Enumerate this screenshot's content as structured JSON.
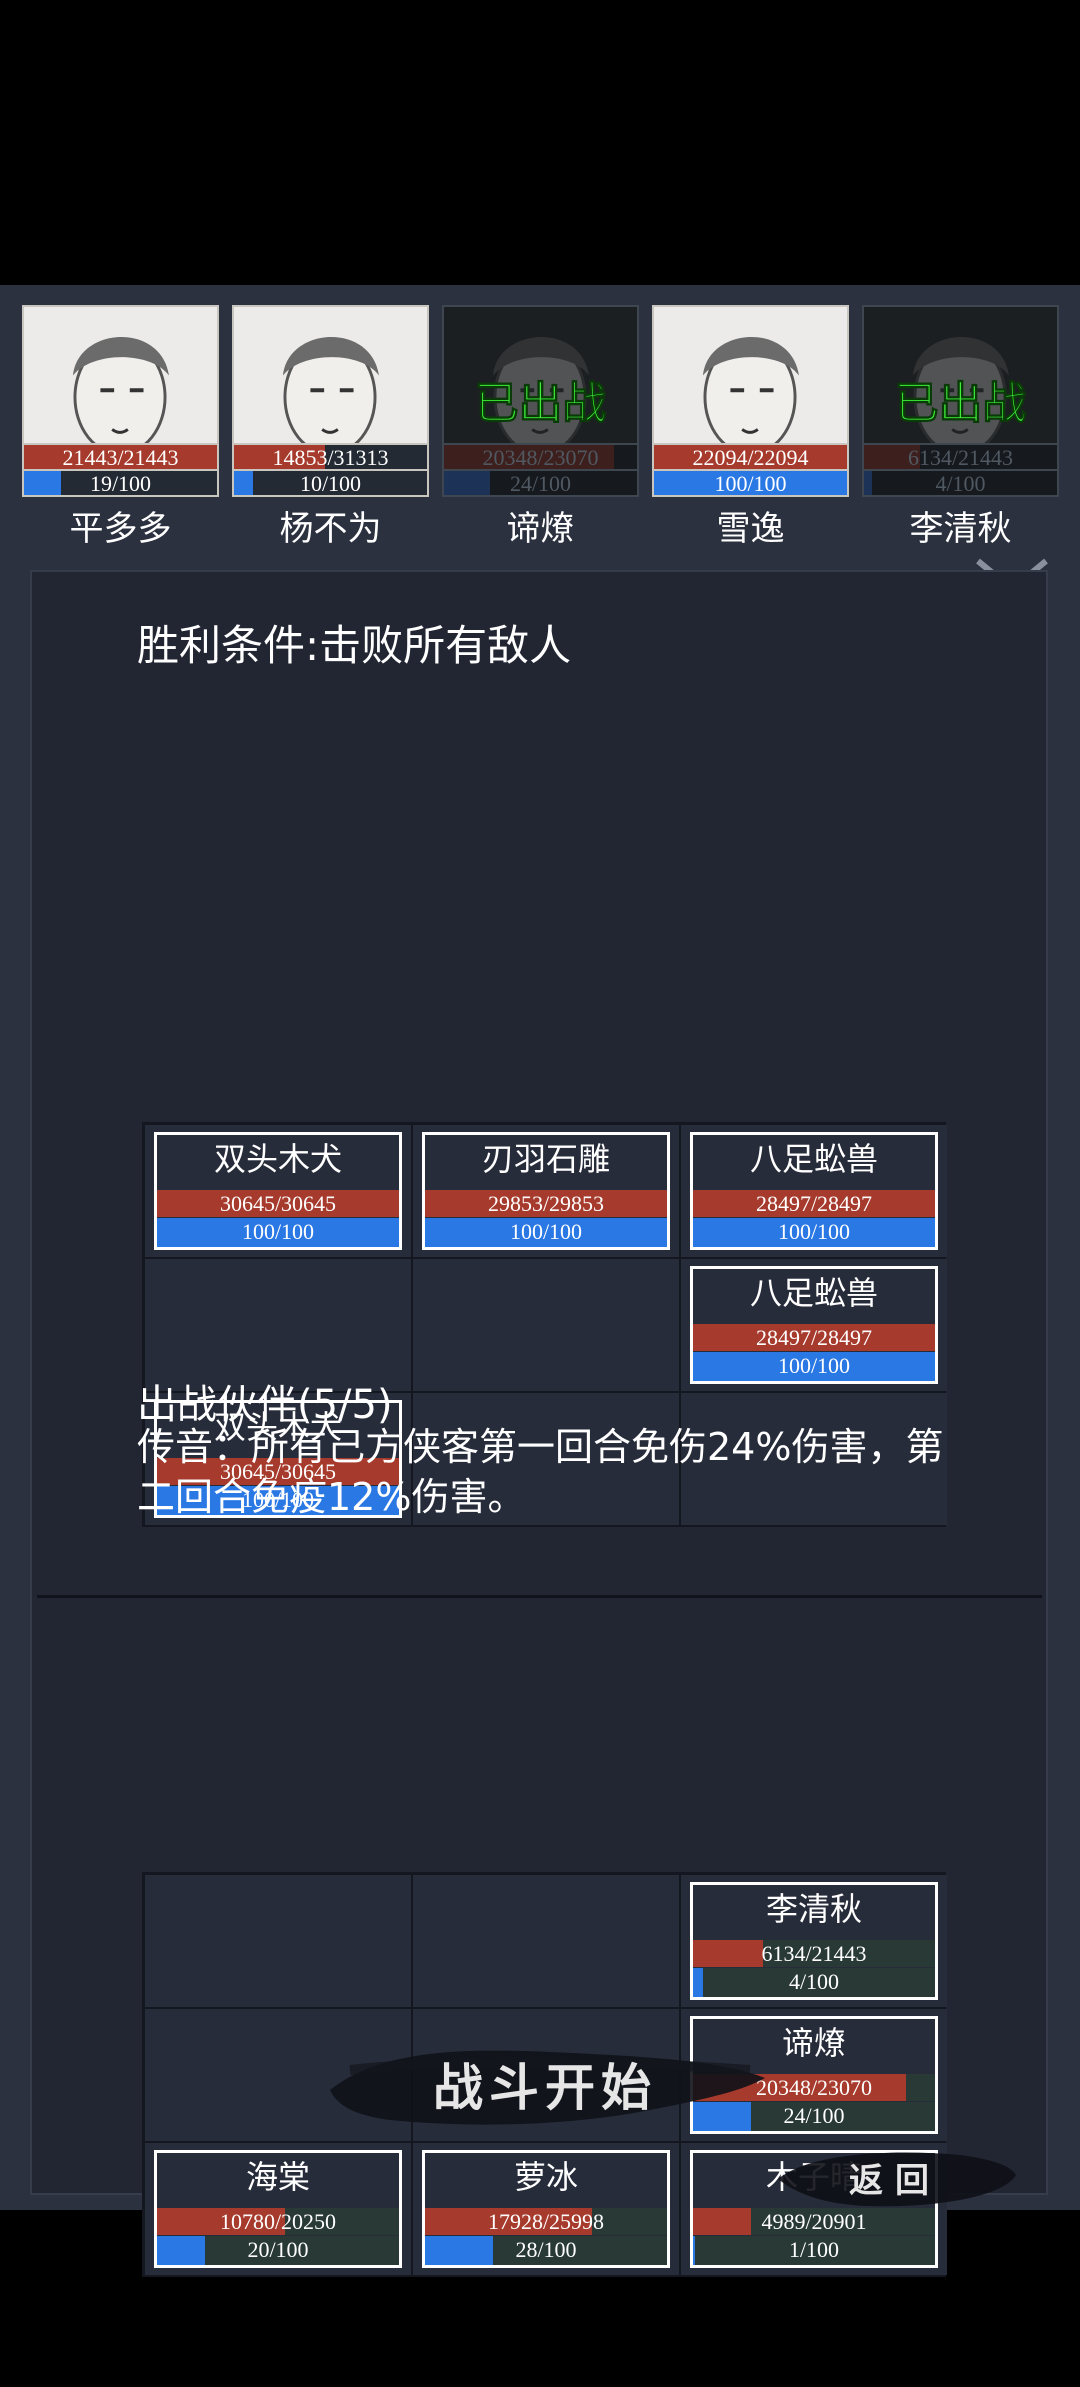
{
  "roster": [
    {
      "name": "平多多",
      "hp": "21443/21443",
      "hp_frac": 1.0,
      "mp": "19/100",
      "mp_frac": 0.19,
      "deployed": false
    },
    {
      "name": "杨不为",
      "hp": "14853/31313",
      "hp_frac": 0.47,
      "mp": "10/100",
      "mp_frac": 0.1,
      "deployed": false
    },
    {
      "name": "谛燎",
      "hp": "20348/23070",
      "hp_frac": 0.88,
      "mp": "24/100",
      "mp_frac": 0.24,
      "deployed": true
    },
    {
      "name": "雪逸",
      "hp": "22094/22094",
      "hp_frac": 1.0,
      "mp": "100/100",
      "mp_frac": 1.0,
      "deployed": false
    },
    {
      "name": "李清秋",
      "hp": "6134/21443",
      "hp_frac": 0.29,
      "mp": "4/100",
      "mp_frac": 0.04,
      "deployed": true
    }
  ],
  "deployed_label": "已出战",
  "victory_condition": "胜利条件:击败所有敌人",
  "enemies": [
    {
      "row": 0,
      "col": 0,
      "name": "双头木犬",
      "hp": "30645/30645",
      "hp_frac": 1.0,
      "mp": "100/100",
      "mp_frac": 1.0
    },
    {
      "row": 0,
      "col": 1,
      "name": "刃羽石雕",
      "hp": "29853/29853",
      "hp_frac": 1.0,
      "mp": "100/100",
      "mp_frac": 1.0
    },
    {
      "row": 0,
      "col": 2,
      "name": "八足蚣兽",
      "hp": "28497/28497",
      "hp_frac": 1.0,
      "mp": "100/100",
      "mp_frac": 1.0
    },
    {
      "row": 1,
      "col": 2,
      "name": "八足蚣兽",
      "hp": "28497/28497",
      "hp_frac": 1.0,
      "mp": "100/100",
      "mp_frac": 1.0
    },
    {
      "row": 2,
      "col": 0,
      "name": "双头木犬",
      "hp": "30645/30645",
      "hp_frac": 1.0,
      "mp": "100/100",
      "mp_frac": 1.0
    }
  ],
  "partners_title": "出战伙伴(5/5)",
  "buff_text": "传音：所有己方侠客第一回合免伤24%伤害，第二回合免疫12%伤害。",
  "partners": [
    {
      "row": 0,
      "col": 2,
      "name": "李清秋",
      "hp": "6134/21443",
      "hp_frac": 0.29,
      "mp": "4/100",
      "mp_frac": 0.04
    },
    {
      "row": 1,
      "col": 2,
      "name": "谛燎",
      "hp": "20348/23070",
      "hp_frac": 0.88,
      "mp": "24/100",
      "mp_frac": 0.24
    },
    {
      "row": 2,
      "col": 0,
      "name": "海棠",
      "hp": "10780/20250",
      "hp_frac": 0.53,
      "mp": "20/100",
      "mp_frac": 0.2
    },
    {
      "row": 2,
      "col": 1,
      "name": "萝冰",
      "hp": "17928/25998",
      "hp_frac": 0.69,
      "mp": "28/100",
      "mp_frac": 0.28
    },
    {
      "row": 2,
      "col": 2,
      "name": "木子晴",
      "hp": "4989/20901",
      "hp_frac": 0.24,
      "mp": "1/100",
      "mp_frac": 0.01
    }
  ],
  "start_label": "战斗开始",
  "back_label": "返回",
  "colors": {
    "hp": "#a63a2c",
    "mp": "#2a78e4",
    "deployed": "#3ef23a",
    "panel": "#222633"
  }
}
